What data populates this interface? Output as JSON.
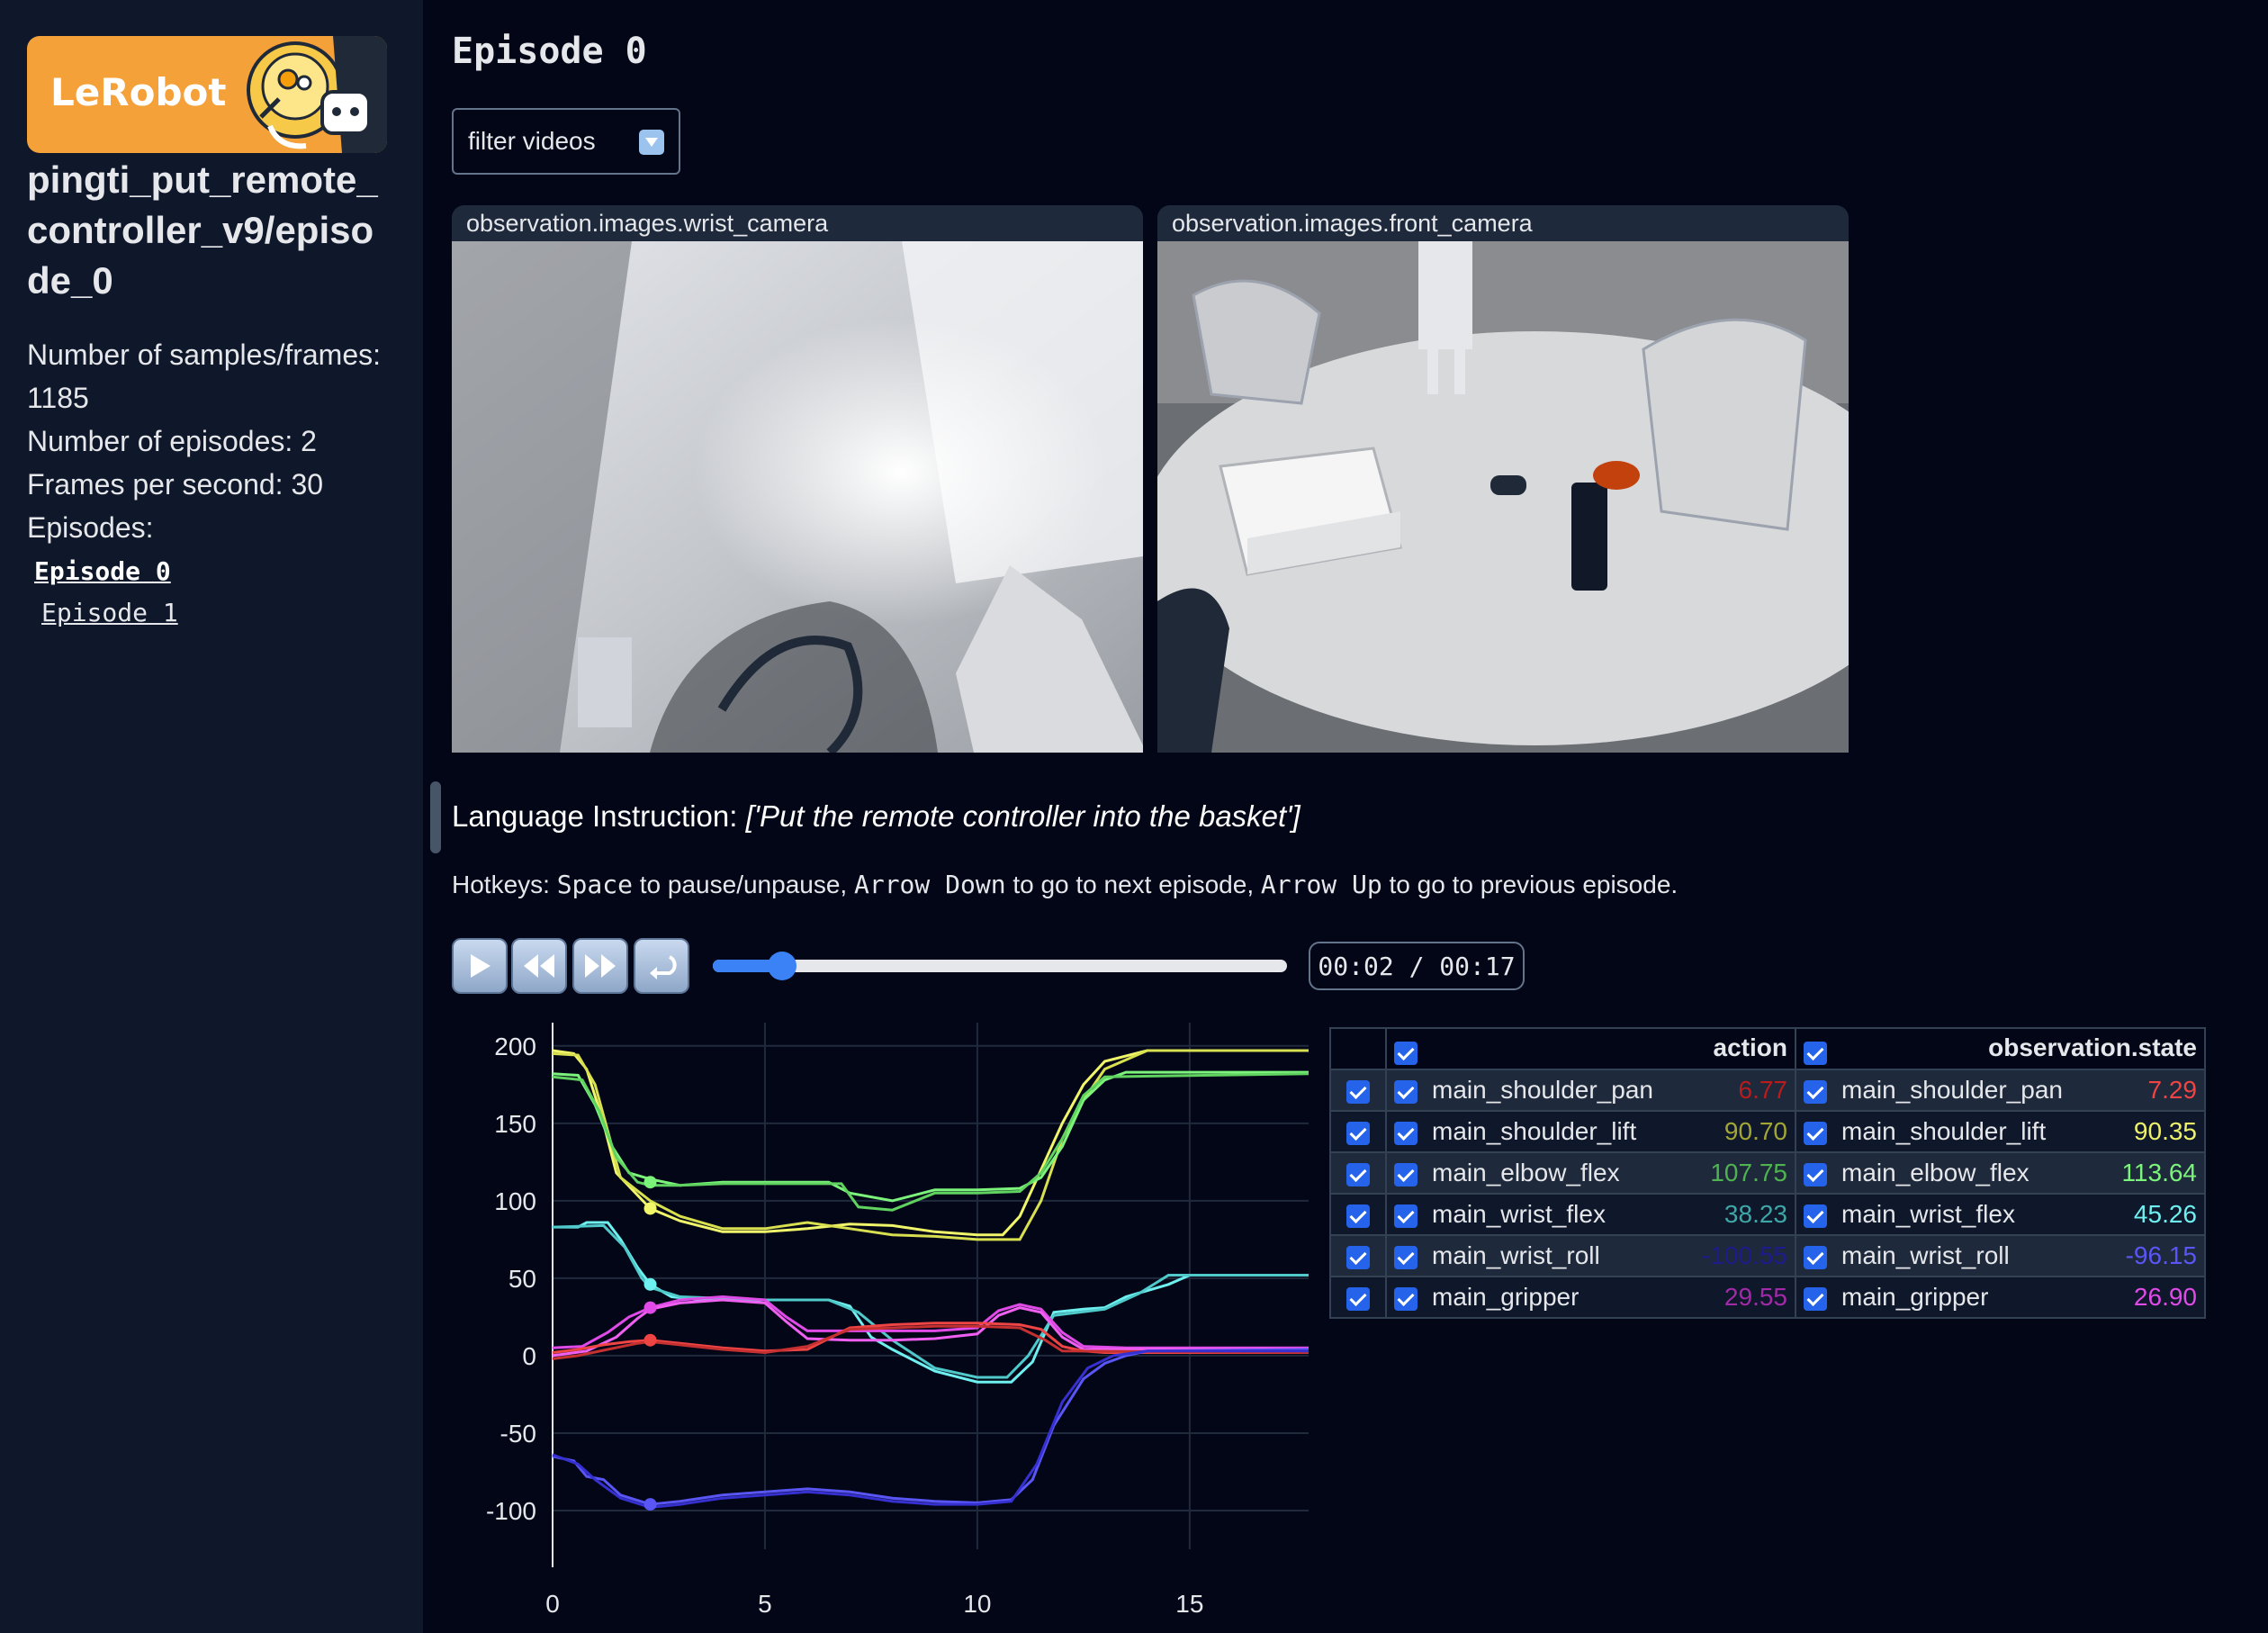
{
  "sidebar": {
    "logo_text": "LeRobot",
    "dataset_title": "pingti_put_remote_controller_v9/episode_0",
    "info": [
      "Number of samples/frames: 1185",
      "Number of episodes: 2",
      "Frames per second: 30",
      "Episodes:"
    ],
    "episodes": [
      "Episode 0",
      "Episode 1"
    ]
  },
  "main": {
    "heading": "Episode 0",
    "filter_label": "filter videos",
    "videos": [
      {
        "label": "observation.images.wrist_camera"
      },
      {
        "label": "observation.images.front_camera"
      }
    ],
    "language_label": "Language Instruction:",
    "language_text": "['Put the remote controller into the basket']",
    "hotkeys": {
      "prefix": "Hotkeys: ",
      "k1": "Space",
      "t1": " to pause/unpause, ",
      "k2": "Arrow Down",
      "t2": " to go to next episode, ",
      "k3": "Arrow Up",
      "t3": " to go to previous episode."
    },
    "player": {
      "time": "00:02 / 00:17",
      "progress": 0.12
    }
  },
  "table": {
    "header_action": "action",
    "header_state": "observation.state",
    "rows": [
      {
        "name": "main_shoulder_pan",
        "action": "6.77",
        "state": "7.29",
        "action_color": "#b91c1c",
        "state_color": "#ef4444"
      },
      {
        "name": "main_shoulder_lift",
        "action": "90.70",
        "state": "90.35",
        "action_color": "#a3a635",
        "state_color": "#eef26a"
      },
      {
        "name": "main_elbow_flex",
        "action": "107.75",
        "state": "113.64",
        "action_color": "#4fb34f",
        "state_color": "#7cf47c"
      },
      {
        "name": "main_wrist_flex",
        "action": "38.23",
        "state": "45.26",
        "action_color": "#3ea6a6",
        "state_color": "#6ff0f0"
      },
      {
        "name": "main_wrist_roll",
        "action": "-100.55",
        "state": "-96.15",
        "action_color": "#1e1b8c",
        "state_color": "#5a56f5"
      },
      {
        "name": "main_gripper",
        "action": "29.55",
        "state": "26.90",
        "action_color": "#a12aa8",
        "state_color": "#e04be8"
      }
    ]
  },
  "chart_data": {
    "type": "line",
    "xlim": [
      0,
      17.8
    ],
    "ylim": [
      -125,
      215
    ],
    "x_ticks": [
      0,
      5,
      10,
      15
    ],
    "y_ticks": [
      200,
      150,
      100,
      50,
      0,
      -50,
      -100
    ],
    "cursor_x": 2.3,
    "grid": true,
    "series": [
      {
        "color": "#f0f56a",
        "points": [
          [
            0,
            197
          ],
          [
            0.5,
            195
          ],
          [
            0.8,
            185
          ],
          [
            1.2,
            150
          ],
          [
            1.5,
            118
          ],
          [
            2.3,
            95
          ],
          [
            3,
            87
          ],
          [
            4,
            80
          ],
          [
            5,
            80
          ],
          [
            6,
            82
          ],
          [
            7,
            85
          ],
          [
            8,
            84
          ],
          [
            9,
            80
          ],
          [
            10,
            78
          ],
          [
            10.6,
            78
          ],
          [
            11,
            90
          ],
          [
            11.5,
            120
          ],
          [
            12,
            150
          ],
          [
            12.5,
            175
          ],
          [
            13,
            190
          ],
          [
            14,
            197
          ],
          [
            17.8,
            197
          ]
        ]
      },
      {
        "color": "#d8e050",
        "points": [
          [
            0,
            195
          ],
          [
            0.6,
            194
          ],
          [
            1,
            175
          ],
          [
            1.3,
            145
          ],
          [
            1.6,
            115
          ],
          [
            2.3,
            100
          ],
          [
            3,
            90
          ],
          [
            4,
            82
          ],
          [
            5,
            82
          ],
          [
            6,
            86
          ],
          [
            7,
            82
          ],
          [
            8,
            78
          ],
          [
            9,
            77
          ],
          [
            10,
            75
          ],
          [
            11,
            75
          ],
          [
            11.5,
            100
          ],
          [
            12,
            140
          ],
          [
            12.5,
            165
          ],
          [
            13,
            185
          ],
          [
            14,
            197
          ],
          [
            17.8,
            197
          ]
        ]
      },
      {
        "color": "#7cf47c",
        "points": [
          [
            0,
            182
          ],
          [
            0.6,
            181
          ],
          [
            1,
            162
          ],
          [
            1.4,
            135
          ],
          [
            1.8,
            118
          ],
          [
            2.3,
            114
          ],
          [
            3,
            110
          ],
          [
            4,
            112
          ],
          [
            5,
            112
          ],
          [
            6.5,
            112
          ],
          [
            7,
            105
          ],
          [
            8,
            100
          ],
          [
            9,
            107
          ],
          [
            10,
            107
          ],
          [
            11,
            108
          ],
          [
            11.5,
            115
          ],
          [
            12,
            135
          ],
          [
            12.5,
            165
          ],
          [
            13,
            178
          ],
          [
            13.5,
            183
          ],
          [
            17.8,
            183
          ]
        ]
      },
      {
        "color": "#5fd25f",
        "points": [
          [
            0,
            180
          ],
          [
            0.7,
            178
          ],
          [
            1.1,
            158
          ],
          [
            1.5,
            128
          ],
          [
            2,
            112
          ],
          [
            2.3,
            110
          ],
          [
            3,
            110
          ],
          [
            4,
            111
          ],
          [
            5,
            111
          ],
          [
            6.8,
            111
          ],
          [
            7.2,
            96
          ],
          [
            8,
            94
          ],
          [
            9,
            105
          ],
          [
            10,
            105
          ],
          [
            11,
            106
          ],
          [
            11.5,
            118
          ],
          [
            12,
            140
          ],
          [
            12.5,
            168
          ],
          [
            13,
            180
          ],
          [
            17.8,
            182
          ]
        ]
      },
      {
        "color": "#6ff0f0",
        "points": [
          [
            0,
            83
          ],
          [
            0.6,
            83
          ],
          [
            0.8,
            86
          ],
          [
            1.3,
            86
          ],
          [
            1.6,
            75
          ],
          [
            2,
            57
          ],
          [
            2.3,
            46
          ],
          [
            2.8,
            38
          ],
          [
            3.5,
            36
          ],
          [
            5,
            36
          ],
          [
            6.5,
            36
          ],
          [
            7,
            32
          ],
          [
            7.5,
            12
          ],
          [
            8,
            4
          ],
          [
            9,
            -10
          ],
          [
            10,
            -17
          ],
          [
            10.8,
            -17
          ],
          [
            11.3,
            -4
          ],
          [
            11.8,
            28
          ],
          [
            12.5,
            30
          ],
          [
            13,
            31
          ],
          [
            13.5,
            38
          ],
          [
            14.5,
            46
          ],
          [
            15,
            52
          ],
          [
            17.8,
            52
          ]
        ]
      },
      {
        "color": "#4fc9c9",
        "points": [
          [
            0,
            83
          ],
          [
            1.2,
            84
          ],
          [
            1.7,
            70
          ],
          [
            2.1,
            50
          ],
          [
            2.3,
            44
          ],
          [
            3,
            38
          ],
          [
            5,
            36
          ],
          [
            6.5,
            36
          ],
          [
            7.2,
            28
          ],
          [
            8,
            10
          ],
          [
            9,
            -8
          ],
          [
            10,
            -14
          ],
          [
            10.7,
            -14
          ],
          [
            11.2,
            0
          ],
          [
            11.8,
            26
          ],
          [
            13,
            30
          ],
          [
            13.8,
            40
          ],
          [
            14.5,
            52
          ],
          [
            17.8,
            52
          ]
        ]
      },
      {
        "color": "#e04be8",
        "points": [
          [
            0,
            5
          ],
          [
            0.7,
            6
          ],
          [
            1.3,
            15
          ],
          [
            1.8,
            25
          ],
          [
            2.3,
            31
          ],
          [
            3,
            36
          ],
          [
            4,
            38
          ],
          [
            5,
            36
          ],
          [
            5.5,
            25
          ],
          [
            6,
            16
          ],
          [
            7,
            16
          ],
          [
            8,
            16
          ],
          [
            9,
            16
          ],
          [
            10,
            18
          ],
          [
            10.5,
            29
          ],
          [
            11,
            33
          ],
          [
            11.5,
            30
          ],
          [
            12,
            15
          ],
          [
            12.5,
            6
          ],
          [
            13.5,
            5
          ],
          [
            17.8,
            5
          ]
        ]
      },
      {
        "color": "#f060f0",
        "points": [
          [
            0,
            0
          ],
          [
            0.8,
            3
          ],
          [
            1.5,
            12
          ],
          [
            2,
            24
          ],
          [
            2.3,
            30
          ],
          [
            3,
            34
          ],
          [
            4,
            36
          ],
          [
            5,
            34
          ],
          [
            5.5,
            22
          ],
          [
            6,
            11
          ],
          [
            7,
            10
          ],
          [
            8,
            10
          ],
          [
            9,
            11
          ],
          [
            10,
            14
          ],
          [
            10.5,
            26
          ],
          [
            11,
            31
          ],
          [
            11.5,
            28
          ],
          [
            12,
            12
          ],
          [
            12.5,
            4
          ],
          [
            17.8,
            4
          ]
        ]
      },
      {
        "color": "#ef4444",
        "points": [
          [
            0,
            2
          ],
          [
            0.6,
            4
          ],
          [
            1.2,
            7
          ],
          [
            1.8,
            9
          ],
          [
            2.3,
            10
          ],
          [
            3,
            8
          ],
          [
            4,
            5
          ],
          [
            5,
            3
          ],
          [
            6,
            4
          ],
          [
            7,
            18
          ],
          [
            8,
            20
          ],
          [
            9,
            21
          ],
          [
            10,
            21
          ],
          [
            11,
            20
          ],
          [
            11.5,
            17
          ],
          [
            12,
            6
          ],
          [
            12.5,
            3
          ],
          [
            13,
            2
          ],
          [
            17.8,
            2
          ]
        ]
      },
      {
        "color": "#c53030",
        "points": [
          [
            0,
            -2
          ],
          [
            0.6,
            0
          ],
          [
            1.3,
            4
          ],
          [
            2,
            8
          ],
          [
            2.3,
            9
          ],
          [
            3,
            7
          ],
          [
            4,
            4
          ],
          [
            5,
            2
          ],
          [
            6,
            6
          ],
          [
            7,
            17
          ],
          [
            8,
            18
          ],
          [
            9,
            19
          ],
          [
            10,
            19
          ],
          [
            11,
            18
          ],
          [
            11.6,
            10
          ],
          [
            12,
            3
          ],
          [
            17.8,
            2
          ]
        ]
      },
      {
        "color": "#5a56f5",
        "points": [
          [
            0,
            -65
          ],
          [
            0.5,
            -68
          ],
          [
            0.8,
            -78
          ],
          [
            1.2,
            -80
          ],
          [
            1.6,
            -90
          ],
          [
            2.3,
            -96
          ],
          [
            3,
            -94
          ],
          [
            4,
            -90
          ],
          [
            5,
            -88
          ],
          [
            6,
            -86
          ],
          [
            7,
            -88
          ],
          [
            8,
            -92
          ],
          [
            9,
            -94
          ],
          [
            10,
            -95
          ],
          [
            10.8,
            -93
          ],
          [
            11.3,
            -80
          ],
          [
            11.8,
            -45
          ],
          [
            12.5,
            -15
          ],
          [
            13,
            -5
          ],
          [
            13.5,
            0
          ],
          [
            14,
            3
          ],
          [
            17.8,
            4
          ]
        ]
      },
      {
        "color": "#3730d0",
        "points": [
          [
            0,
            -64
          ],
          [
            0.6,
            -70
          ],
          [
            1,
            -80
          ],
          [
            1.6,
            -92
          ],
          [
            2.3,
            -98
          ],
          [
            3,
            -96
          ],
          [
            4,
            -92
          ],
          [
            5,
            -90
          ],
          [
            6,
            -88
          ],
          [
            7,
            -90
          ],
          [
            8,
            -94
          ],
          [
            9,
            -96
          ],
          [
            10,
            -96
          ],
          [
            10.8,
            -94
          ],
          [
            11.4,
            -70
          ],
          [
            12,
            -30
          ],
          [
            12.6,
            -8
          ],
          [
            13.2,
            0
          ],
          [
            14,
            3
          ],
          [
            17.8,
            3
          ]
        ]
      }
    ],
    "markers": [
      {
        "y": 112,
        "color": "#7cf47c"
      },
      {
        "y": 95,
        "color": "#f0f56a"
      },
      {
        "y": 46,
        "color": "#6ff0f0"
      },
      {
        "y": 31,
        "color": "#e04be8"
      },
      {
        "y": 10,
        "color": "#ef4444"
      },
      {
        "y": -96,
        "color": "#5a56f5"
      }
    ]
  }
}
